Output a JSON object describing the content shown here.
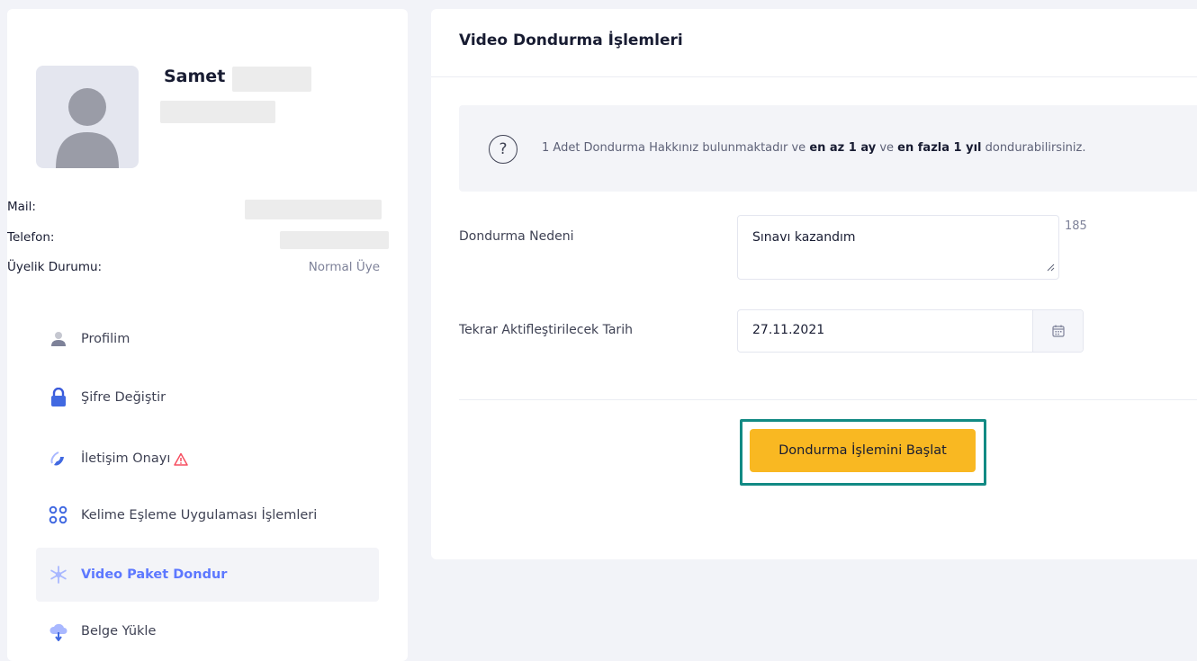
{
  "profile": {
    "first_name": "Samet",
    "mail_label": "Mail:",
    "phone_label": "Telefon:",
    "membership_label": "Üyelik Durumu:",
    "membership_value": "Normal Üye"
  },
  "nav": {
    "items": [
      {
        "label": "Profilim",
        "icon": "user-icon"
      },
      {
        "label": "Şifre Değiştir",
        "icon": "lock-icon"
      },
      {
        "label": "İletişim Onayı",
        "icon": "phone-icon",
        "warning": true
      },
      {
        "label": "Kelime Eşleme Uygulaması İşlemleri",
        "icon": "grid-dots-icon"
      },
      {
        "label": "Video Paket Dondur",
        "icon": "snowflake-icon",
        "active": true
      },
      {
        "label": "Belge Yükle",
        "icon": "cloud-upload-icon"
      }
    ]
  },
  "main": {
    "title": "Video Dondurma İşlemleri",
    "info": {
      "prefix": "1 Adet Dondurma Hakkınız bulunmaktadır ve ",
      "bold1": "en az 1 ay",
      "middle": " ve ",
      "bold2": "en fazla 1 yıl",
      "suffix": " dondurabilirsiniz."
    },
    "reason_label": "Dondurma Nedeni",
    "reason_value": "Sınavı kazandım",
    "char_counter": "185",
    "date_label": "Tekrar Aktifleştirilecek Tarih",
    "date_value": "27.11.2021",
    "start_button": "Dondurma İşlemini Başlat"
  },
  "colors": {
    "accent": "#5d78ff",
    "button": "#f9b822",
    "highlight_border": "#128a84",
    "warning": "#f64e60"
  }
}
